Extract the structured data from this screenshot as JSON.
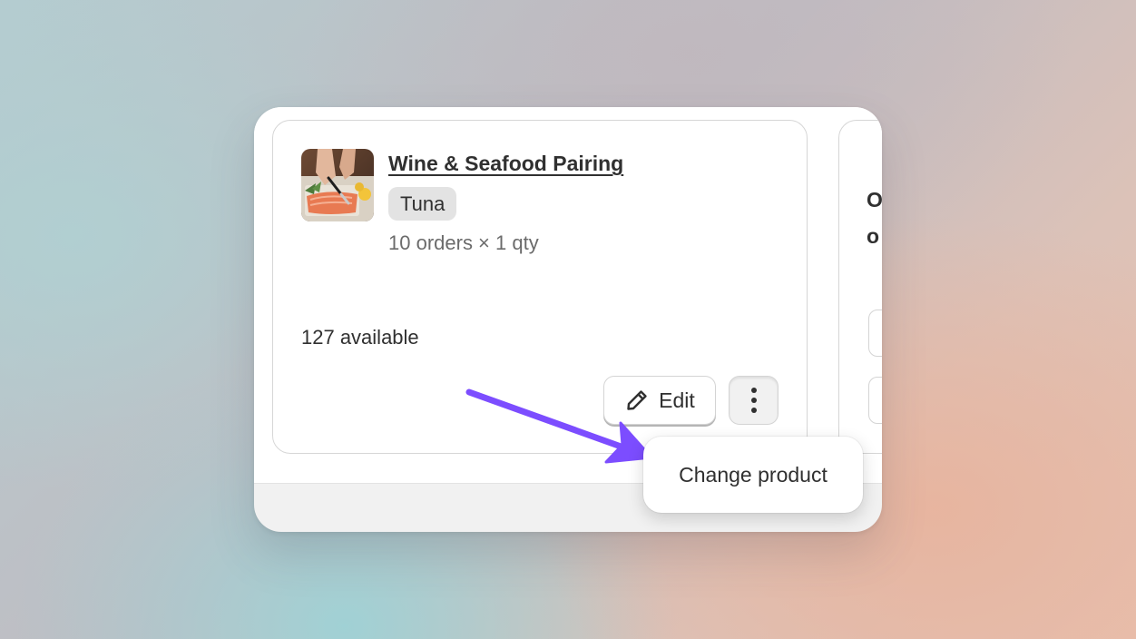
{
  "product_card": {
    "title": "Wine & Seafood Pairing",
    "variant_badge": "Tuna",
    "order_summary": "10 orders × 1 qty",
    "availability": "127 available",
    "thumbnail_icon": "product-photo-icon",
    "edit_label": "Edit",
    "edit_icon": "pencil-icon",
    "more_icon": "vertical-ellipsis-icon"
  },
  "adjacent_card": {
    "heading_fragment_1": "O",
    "heading_fragment_2": "o"
  },
  "actions_menu": {
    "items": [
      {
        "label": "Change product"
      }
    ]
  },
  "annotation": {
    "arrow_color": "#7c4dff"
  }
}
